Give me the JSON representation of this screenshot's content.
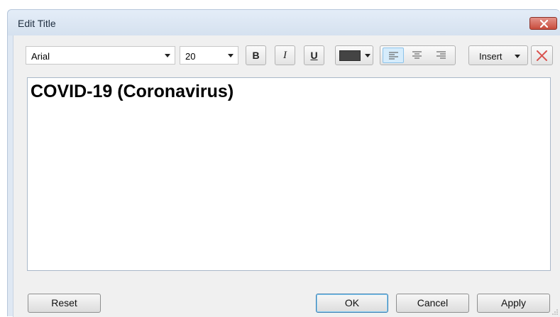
{
  "window": {
    "title": "Edit Title",
    "close_icon": "close-x-icon"
  },
  "toolbar": {
    "font_family": "Arial",
    "font_size": "20",
    "bold_label": "B",
    "italic_label": "I",
    "underline_label": "U",
    "text_color": "#444444",
    "alignment": "left",
    "align_icons": [
      "align-left-icon",
      "align-center-icon",
      "align-right-icon"
    ],
    "insert_label": "Insert",
    "clear_icon": "clear-x-icon"
  },
  "editor": {
    "text": "COVID-19 (Coronavirus)"
  },
  "buttons": {
    "reset": "Reset",
    "ok": "OK",
    "cancel": "Cancel",
    "apply": "Apply"
  },
  "colors": {
    "close_button": "#c84c3c",
    "clear_icon": "#d9534f",
    "active_align": "#d6ecfb"
  }
}
